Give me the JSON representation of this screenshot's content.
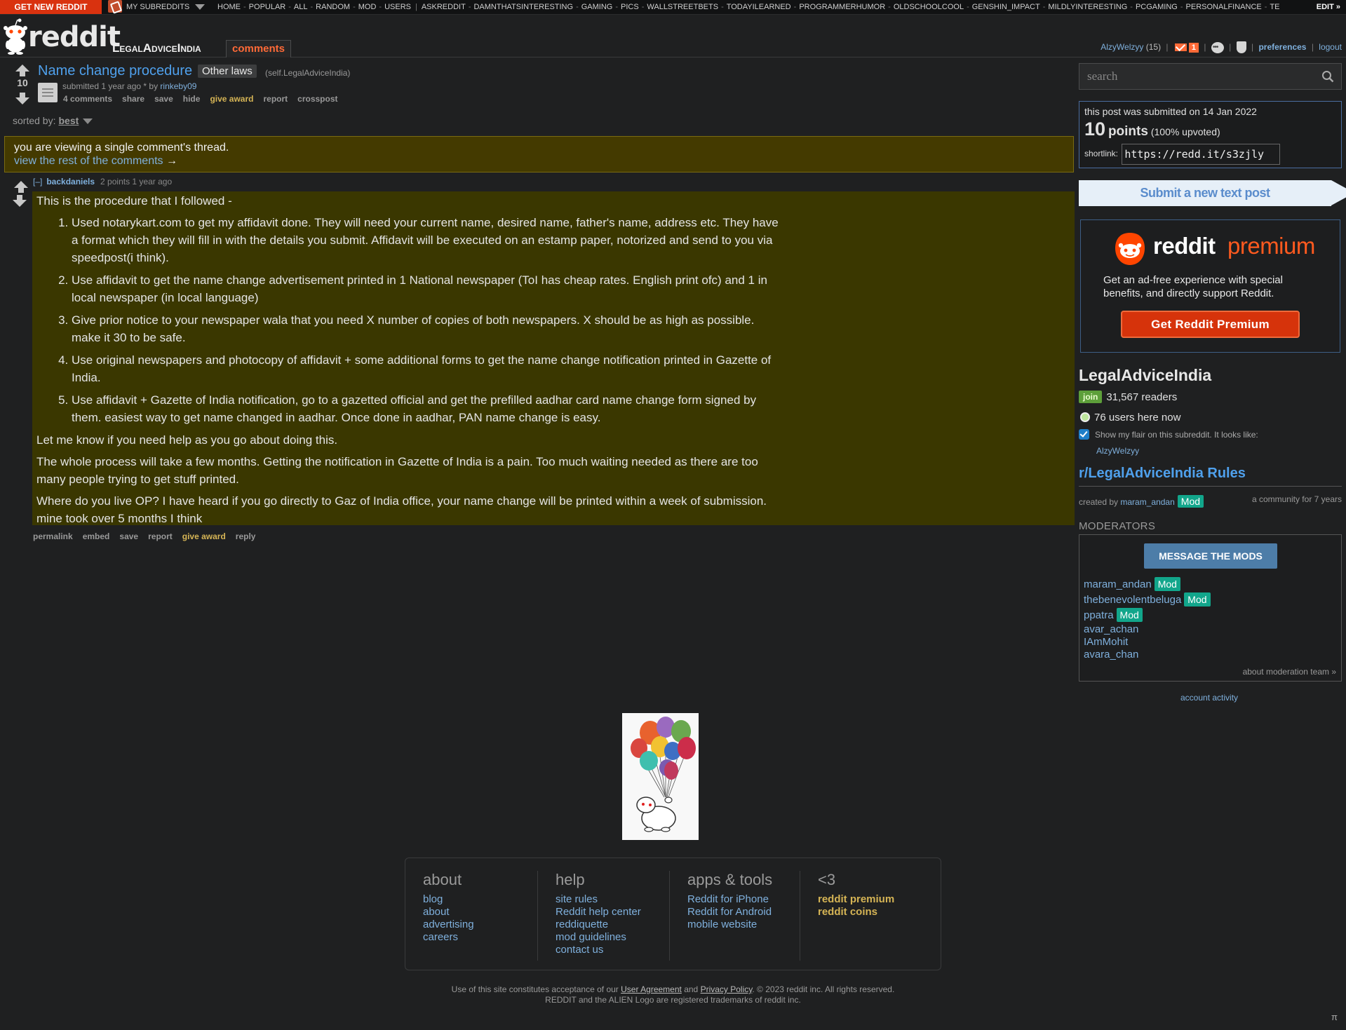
{
  "topbar": {
    "get_new": "GET NEW REDDIT",
    "my_subreddits": "MY SUBREDDITS",
    "links": [
      "HOME",
      "POPULAR",
      "ALL",
      "RANDOM",
      "MOD",
      "USERS"
    ],
    "subreddits": [
      "ASKREDDIT",
      "DAMNTHATSINTERESTING",
      "GAMING",
      "PICS",
      "WALLSTREETBETS",
      "TODAYILEARNED",
      "PROGRAMMERHUMOR",
      "OLDSCHOOLCOOL",
      "GENSHIN_IMPACT",
      "MILDLYINTERESTING",
      "PCGAMING",
      "PERSONALFINANCE",
      "TE"
    ],
    "edit": "EDIT »"
  },
  "header": {
    "wordmark": "reddit",
    "subreddit": "LegalAdviceIndia",
    "tab": "comments",
    "user": "AlzyWelzyy",
    "karma": "(15)",
    "mail_count": "1",
    "preferences": "preferences",
    "logout": "logout"
  },
  "post": {
    "score": "10",
    "title": "Name change procedure",
    "flair": "Other laws",
    "domain": "(self.LegalAdviceIndia)",
    "tagline_prefix": "submitted 1 year ago * by",
    "author": "rinkeby09",
    "buttons": [
      "4 comments",
      "share",
      "save",
      "hide",
      "give award",
      "report",
      "crosspost"
    ]
  },
  "sort": {
    "label": "sorted by:",
    "value": "best"
  },
  "notice": {
    "text": "you are viewing a single comment's thread.",
    "link": "view the rest of the comments",
    "arrow": "→"
  },
  "comment": {
    "collapse": "[–]",
    "author": "backdaniels",
    "meta": "2 points 1 year ago",
    "intro": "This is the procedure that I followed -",
    "steps": [
      "Used notarykart.com to get my affidavit done. They will need your current name, desired name, father's name, address etc. They have a format which they will fill in with the details you submit. Affidavit will be executed on an estamp paper, notorized and send to you via speedpost(i think).",
      "Use affidavit to get the name change advertisement printed in 1 National newspaper (ToI has cheap rates. English print ofc) and 1 in local newspaper (in local language)",
      "Give prior notice to your newspaper wala that you need X number of copies of both newspapers. X should be as high as possible. make it 30 to be safe.",
      "Use original newspapers and photocopy of affidavit + some additional forms to get the name change notification printed in Gazette of India.",
      "Use affidavit + Gazette of India notification, go to a gazetted official and get the prefilled aadhar card name change form signed by them. easiest way to get name changed in aadhar. Once done in aadhar, PAN name change is easy."
    ],
    "para1": "Let me know if you need help as you go about doing this.",
    "para2": "The whole process will take a few months. Getting the notification in Gazette of India is a pain. Too much waiting needed as there are too many people trying to get stuff printed.",
    "para3": "Where do you live OP? I have heard if you go directly to Gaz of India office, your name change will be printed within a week of submission. mine took over 5 months I think",
    "buttons": [
      "permalink",
      "embed",
      "save",
      "report",
      "give award",
      "reply"
    ]
  },
  "sidebar": {
    "search_placeholder": "search",
    "submitted_on": "this post was submitted on 14 Jan 2022",
    "points": "10",
    "points_label": "points",
    "upvoted": "(100% upvoted)",
    "shortlink_label": "shortlink:",
    "shortlink": "https://redd.it/s3zjly",
    "submit_text": "Submit a new text post",
    "premium_brand": "reddit",
    "premium_word": "premium",
    "premium_text": "Get an ad-free experience with special benefits, and directly support Reddit.",
    "premium_button": "Get Reddit Premium",
    "sub_name": "LegalAdviceIndia",
    "join": "join",
    "readers": "31,567 readers",
    "online": "76 users here now",
    "flair_text": "Show my flair on this subreddit. It looks like:",
    "flair_user": "AlzyWelzyy",
    "rules": "r/LegalAdviceIndia Rules",
    "created_by": "created by",
    "creator": "maram_andan",
    "mod_badge": "Mod",
    "community_age": "a community for 7 years",
    "moderators_title": "MODERATORS",
    "message_mods": "MESSAGE THE MODS",
    "mods": [
      "maram_andan",
      "thebenevolentbeluga",
      "ppatra",
      "avar_achan",
      "IAmMohit",
      "avara_chan"
    ],
    "about_mods": "about moderation team »",
    "account_activity": "account activity"
  },
  "footer": {
    "about_title": "about",
    "about": [
      "blog",
      "about",
      "advertising",
      "careers"
    ],
    "help_title": "help",
    "help": [
      "site rules",
      "Reddit help center",
      "reddiquette",
      "mod guidelines",
      "contact us"
    ],
    "apps_title": "apps & tools",
    "apps": [
      "Reddit for iPhone",
      "Reddit for Android",
      "mobile website"
    ],
    "love_title": "<3",
    "love": [
      "reddit premium",
      "reddit coins"
    ],
    "legal_prefix": "Use of this site constitutes acceptance of our",
    "user_agreement": "User Agreement",
    "and": "and",
    "privacy": "Privacy Policy",
    "legal_suffix": ". © 2023 reddit inc. All rights reserved.",
    "trademark": "REDDIT and the ALIEN Logo are registered trademarks of reddit inc.",
    "pi": "π"
  },
  "colors": {
    "accent_orange": "#ff4500",
    "link_blue": "#7fb0dd",
    "highlight": "#3a3700",
    "mod_green": "#12a68b"
  }
}
